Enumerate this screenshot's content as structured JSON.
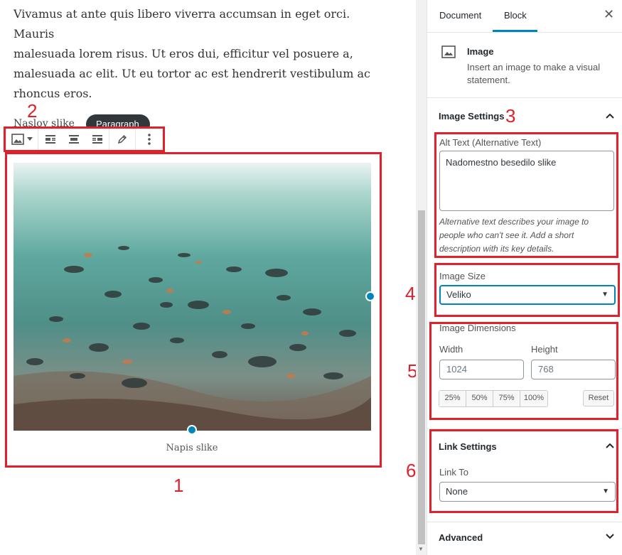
{
  "editor": {
    "paragraph_lines": [
      "Vivamus at ante quis libero viverra accumsan in eget orci. Mauris",
      "malesuada lorem risus. Ut eros dui, efficitur vel posuere a,",
      "malesuada ac elit. Ut eu tortor ac est hendrerit vestibulum ac",
      "rhoncus eros."
    ],
    "block_label": "Naslov slike",
    "breadcrumb_pill": "Paragraph",
    "caption": "Napis slike",
    "toolbar": {
      "image_icon": "image-icon",
      "align_left_icon": "align-left-icon",
      "align_center_icon": "align-center-icon",
      "align_right_icon": "align-right-icon",
      "edit_icon": "pencil-icon",
      "more_icon": "more-vertical-icon"
    }
  },
  "annotations": {
    "n1": "1",
    "n2": "2",
    "n3": "3",
    "n4": "4",
    "n5": "5",
    "n6": "6"
  },
  "sidebar": {
    "tabs": [
      "Document",
      "Block"
    ],
    "active_tab": "Block",
    "close_icon": "close-icon",
    "block_card": {
      "icon": "image-icon",
      "title": "Image",
      "description": "Insert an image to make a visual statement."
    },
    "image_settings": {
      "title": "Image Settings",
      "alt_label": "Alt Text (Alternative Text)",
      "alt_value": "Nadomestno besedilo slike",
      "alt_help": "Alternative text describes your image to people who can't see it. Add a short description with its key details.",
      "size_label": "Image Size",
      "size_value": "Veliko",
      "dimensions_label": "Image Dimensions",
      "width_label": "Width",
      "height_label": "Height",
      "width_placeholder": "1024",
      "height_placeholder": "768",
      "percent_buttons": [
        "25%",
        "50%",
        "75%",
        "100%"
      ],
      "reset_label": "Reset"
    },
    "link_settings": {
      "title": "Link Settings",
      "link_to_label": "Link To",
      "link_to_value": "None"
    },
    "advanced": {
      "title": "Advanced"
    }
  },
  "colors": {
    "accent": "#0085ba",
    "annotation": "#e0212b"
  }
}
